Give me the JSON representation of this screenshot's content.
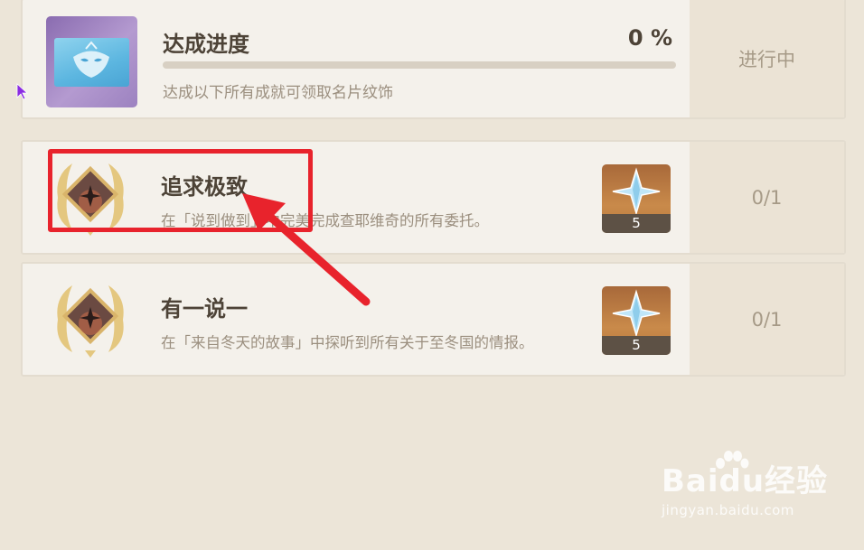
{
  "progress": {
    "title": "达成进度",
    "percent_label": "0 %",
    "progress_value": 0,
    "description": "达成以下所有成就可领取名片纹饰",
    "status": "进行中"
  },
  "achievements": [
    {
      "title": "追求极致",
      "description": "在「说到做到」中完美完成查耶维奇的所有委托。",
      "reward_count": "5",
      "progress": "0/1"
    },
    {
      "title": "有一说一",
      "description": "在「来自冬天的故事」中探听到所有关于至冬国的情报。",
      "reward_count": "5",
      "progress": "0/1"
    }
  ],
  "watermark": {
    "logo": "Baidu经验",
    "url": "jingyan.baidu.com"
  },
  "colors": {
    "background": "#ece5d8",
    "card": "#f4f1eb",
    "highlight": "#e8232c",
    "title_text": "#4d4337"
  }
}
